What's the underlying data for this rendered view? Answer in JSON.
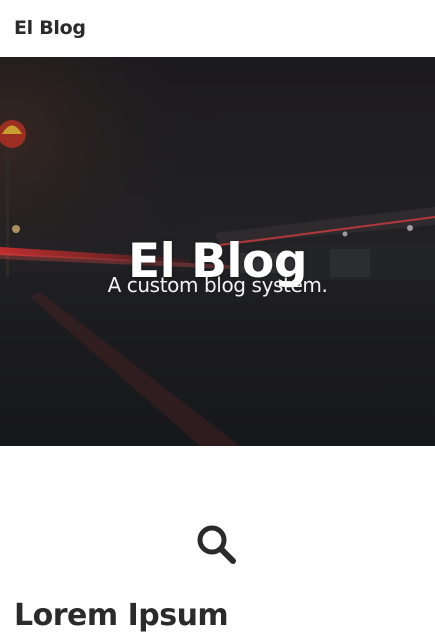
{
  "navbar": {
    "brand": "El Blog"
  },
  "hero": {
    "title": "El Blog",
    "subtitle": "A custom blog system."
  },
  "search": {
    "icon": "search-icon"
  },
  "posts": [
    {
      "title": "Lorem Ipsum"
    }
  ],
  "colors": {
    "text_dark": "#2b2b2b",
    "hero_bg": "#1c1d22",
    "hero_text": "#ffffff"
  }
}
